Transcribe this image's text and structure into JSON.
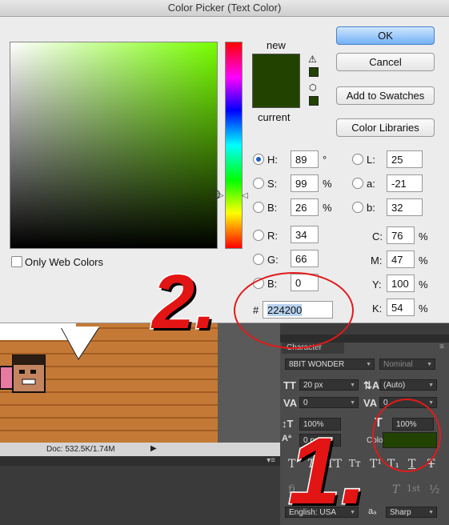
{
  "dialog": {
    "title": "Color Picker (Text Color)",
    "new_label": "new",
    "current_label": "current",
    "new_color": "#224200",
    "current_color": "#224200",
    "only_web_colors_label": "Only Web Colors",
    "buttons": {
      "ok": "OK",
      "cancel": "Cancel",
      "add_to_swatches": "Add to Swatches",
      "color_libraries": "Color Libraries"
    },
    "hsb": [
      {
        "label": "H:",
        "value": "89",
        "unit": "°",
        "selected": true
      },
      {
        "label": "S:",
        "value": "99",
        "unit": "%"
      },
      {
        "label": "B:",
        "value": "26",
        "unit": "%"
      }
    ],
    "rgb": [
      {
        "label": "R:",
        "value": "34"
      },
      {
        "label": "G:",
        "value": "66"
      },
      {
        "label": "B:",
        "value": "0"
      }
    ],
    "lab": [
      {
        "label": "L:",
        "value": "25"
      },
      {
        "label": "a:",
        "value": "-21"
      },
      {
        "label": "b:",
        "value": "32"
      }
    ],
    "cmyk": [
      {
        "label": "C:",
        "value": "76",
        "unit": "%"
      },
      {
        "label": "M:",
        "value": "47",
        "unit": "%"
      },
      {
        "label": "Y:",
        "value": "100",
        "unit": "%"
      },
      {
        "label": "K:",
        "value": "54",
        "unit": "%"
      }
    ],
    "hex_label": "#",
    "hex_value": "224200"
  },
  "status_bar": {
    "doc": "Doc: 532.5K/1.74M"
  },
  "character_panel": {
    "tab": "Character",
    "font_family": "8BIT WONDER",
    "font_style": "Nominal",
    "font_size": "20 px",
    "leading": "(Auto)",
    "kerning": "0",
    "tracking": "0",
    "vertical_scale": "100%",
    "horizontal_scale": "100%",
    "baseline_shift": "0 px",
    "color_label": "Color:",
    "color": "#224200",
    "language": "English: USA",
    "antialias_icon_text": "aₐ",
    "antialias": "Sharp",
    "style_buttons": [
      "T",
      "T",
      "TT",
      "Tt",
      "T'",
      "T,",
      "T",
      "T"
    ],
    "opentype_buttons": [
      "fi",
      "σ",
      "st",
      "A",
      "ad",
      "T",
      "1st",
      "½"
    ]
  },
  "annotations": {
    "step1": "1.",
    "step2": "2."
  }
}
